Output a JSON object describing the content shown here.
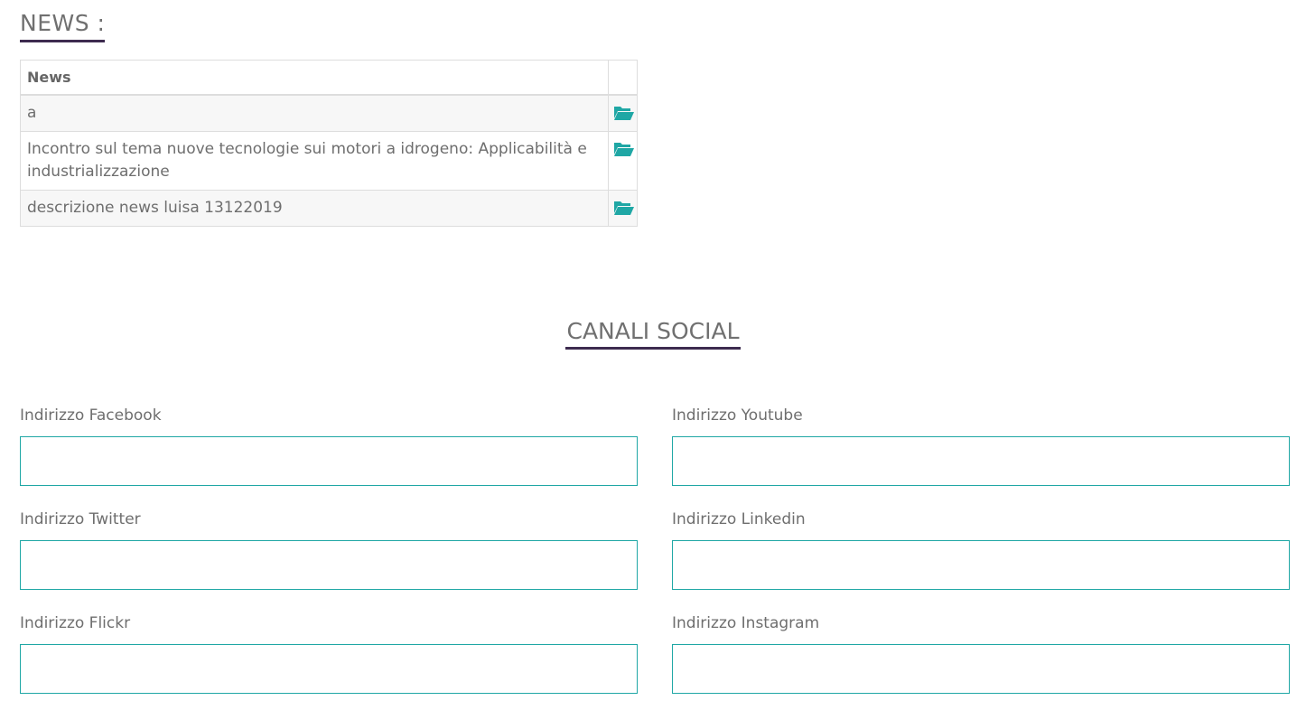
{
  "news_section": {
    "heading": "NEWS :",
    "table_header": "News",
    "rows": [
      {
        "text": "a",
        "icon": "folder-open-icon"
      },
      {
        "text": "Incontro sul tema nuove tecnologie sui motori a idrogeno: Applicabilità e industrializzazione",
        "icon": "folder-open-icon"
      },
      {
        "text": "descrizione news luisa 13122019",
        "icon": "folder-open-icon"
      }
    ]
  },
  "social_section": {
    "heading": "CANALI SOCIAL",
    "fields": {
      "facebook": {
        "label": "Indirizzo Facebook",
        "value": ""
      },
      "youtube": {
        "label": "Indirizzo Youtube",
        "value": ""
      },
      "twitter": {
        "label": "Indirizzo Twitter",
        "value": ""
      },
      "linkedin": {
        "label": "Indirizzo Linkedin",
        "value": ""
      },
      "flickr": {
        "label": "Indirizzo Flickr",
        "value": ""
      },
      "instagram": {
        "label": "Indirizzo Instagram",
        "value": ""
      }
    }
  },
  "colors": {
    "accent": "#1fa7a5",
    "heading_underline": "#3d2b4f",
    "text": "#6e6e6e"
  }
}
